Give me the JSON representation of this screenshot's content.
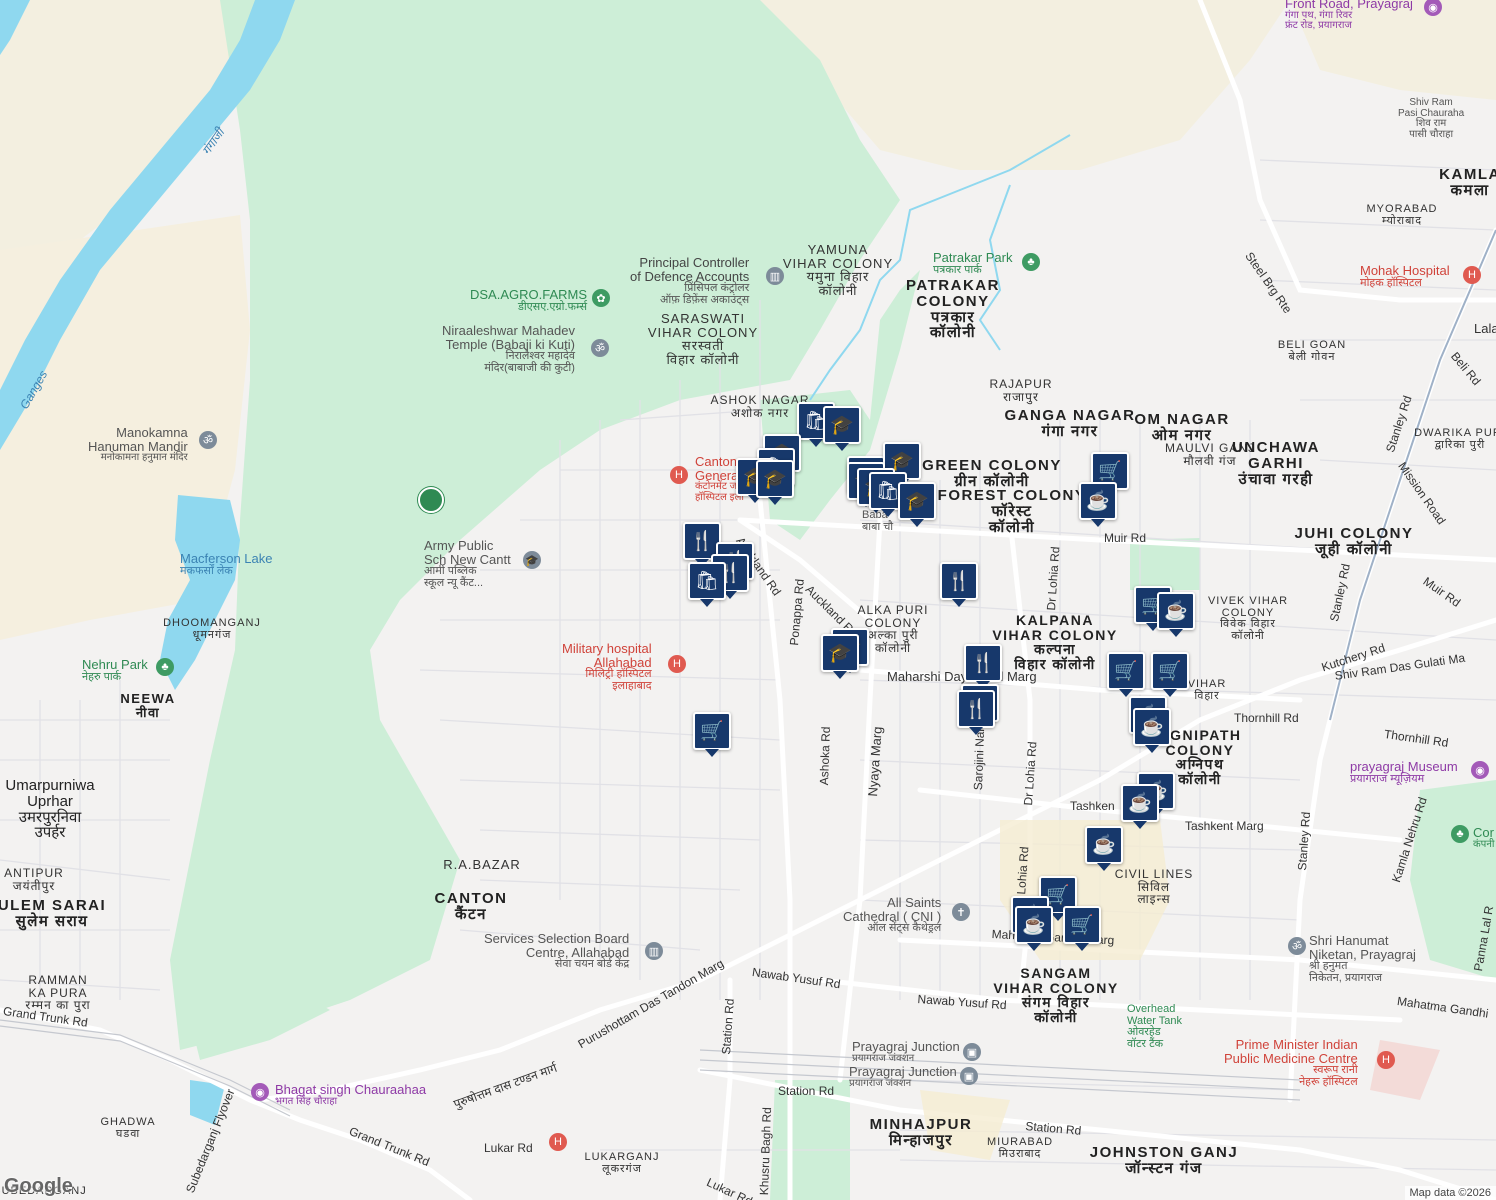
{
  "map": {
    "attribution": "Map data ©2026",
    "logo": "Google",
    "colors": {
      "land": "#f3f2f1",
      "park": "#c8efd5",
      "water": "#8fd8ef",
      "road": "#ffffff",
      "pin": "#17386b"
    },
    "area_labels": [
      {
        "t": "YAMUNA",
        "t2": "VIHAR COLONY",
        "t3": "यमुना विहार",
        "t4": "कॉलोनी"
      },
      {
        "t": "SARASWATI",
        "t2": "VIHAR COLONY",
        "t3": "सरस्वती",
        "t4": "विहार कॉलोनी"
      },
      {
        "t": "PATRAKAR",
        "t2": "COLONY",
        "t3": "पत्रकार",
        "t4": "कॉलोनी"
      },
      {
        "t": "ASHOK NAGAR",
        "t2": "अशोक नगर"
      },
      {
        "t": "RAJAPUR",
        "t2": "राजापुर"
      },
      {
        "t": "GANGA NAGAR",
        "t2": "गंगा नगर"
      },
      {
        "t": "OM NAGAR",
        "t2": "ओम नगर"
      },
      {
        "t": "MAULVI GANJ",
        "t2": "मौलवी गंज"
      },
      {
        "t": "UNCHAWA",
        "t2": "GARHI",
        "t3": "उंचावा गरही"
      },
      {
        "t": "GREEN COLONY",
        "t2": "ग्रीन कॉलोनी"
      },
      {
        "t": "FOREST COLONY",
        "t2": "फॉरेस्ट",
        "t3": "कॉलोनी"
      },
      {
        "t": "JUHI COLONY",
        "t2": "जूही कॉलोनी"
      },
      {
        "t": "BELI GOAN",
        "t2": "बेली गोवन"
      },
      {
        "t": "DWARIKA PURI",
        "t2": "द्वारिका पुरी"
      },
      {
        "t": "KAMLA",
        "t2": "कमला"
      },
      {
        "t": "MYORABAD",
        "t2": "म्योराबाद"
      },
      {
        "t": "ALKA PURI",
        "t2": "COLONY",
        "t3": "अल्का पुरी",
        "t4": "कॉलोनी"
      },
      {
        "t": "KALPANA",
        "t2": "VIHAR COLONY",
        "t3": "कल्पना",
        "t4": "विहार कॉलोनी"
      },
      {
        "t": "VIVEK VIHAR",
        "t2": "COLONY",
        "t3": "विवेक विहार",
        "t4": "कॉलोनी"
      },
      {
        "t": "AGNIPATH",
        "t2": "COLONY",
        "t3": "अग्निपथ",
        "t4": "कॉलोनी"
      },
      {
        "t": "CIVIL LINES",
        "t2": "सिविल",
        "t3": "लाइन्स"
      },
      {
        "t": "NEEWA",
        "t2": "नीवा"
      },
      {
        "t": "DHOOMANGANJ",
        "t2": "धूमनगंज"
      },
      {
        "t": "Umarpurniwa",
        "t2": "Uprhar",
        "t3": "उमरपुरनिवा",
        "t4": "उपर्हर"
      },
      {
        "t": "ANTIPUR",
        "t2": "जयंतीपुर"
      },
      {
        "t": "ULEM SARAI",
        "t2": "सुलेम सराय"
      },
      {
        "t": "RAMMAN",
        "t2": "KA PURA",
        "t3": "रम्मन का पुरा"
      },
      {
        "t": "R.A.BAZAR"
      },
      {
        "t": "CANTON",
        "t2": "कैंटन"
      },
      {
        "t": "SANGAM",
        "t2": "VIHAR COLONY",
        "t3": "संगम विहार",
        "t4": "कॉलोनी"
      },
      {
        "t": "MINHAJPUR",
        "t2": "मिन्हाजपुर"
      },
      {
        "t": "MIURABAD",
        "t2": "मिउराबाद"
      },
      {
        "t": "JOHNSTON GANJ",
        "t2": "जॉन्स्टन गंज"
      },
      {
        "t": "GHADWA",
        "t2": "घडवा"
      },
      {
        "t": "LUKARGANJ",
        "t2": "लूकरगंज"
      },
      {
        "t": "SUBEDARGANJ"
      }
    ],
    "poi_labels": [
      {
        "t": "Principal Controller",
        "t2": "of Defence Accounts",
        "t3": "प्रिंसिपल कंट्रोलर",
        "t4": "ऑफ़ डिफ़ेंस अकाउंट्स"
      },
      {
        "t": "DSA.AGRO.FARMS",
        "t2": "डीएसए.एग्रो.फर्म्स"
      },
      {
        "t": "Niraaleshwar Mahadev",
        "t2": "Temple (Babaji ki Kuti)",
        "t3": "निरालेश्वर महादेव",
        "t4": "मंदिर(बाबाजी की कुटी)"
      },
      {
        "t": "Manokamna",
        "t2": "Hanuman Mandir",
        "t3": "मनोकामना हनुमान मंदिर"
      },
      {
        "t": "Cantonm",
        "t2": "Genera",
        "t3": "कंटोनमेंट ज",
        "t4": "हॉस्पिटल इला"
      },
      {
        "t": "Army Public",
        "t2": "Sch New Cantt",
        "t3": "आर्मी पब्लिक",
        "t4": "स्कूल न्यू कैंट..."
      },
      {
        "t": "Macferson Lake",
        "t2": "मकफर्सों लेक"
      },
      {
        "t": "Nehru Park",
        "t2": "नेहरु पार्क"
      },
      {
        "t": "Military hospital",
        "t2": "Allahabad",
        "t3": "मिलिट्री हॉस्पिटल",
        "t4": "इलाहाबाद"
      },
      {
        "t": "Patrakar Park",
        "t2": "पत्रकार पार्क"
      },
      {
        "t": "Mohak Hospital",
        "t2": "मोहक हॉस्पिटल"
      },
      {
        "t": "Front Road, Prayagraj",
        "t2": "गंगा पथ, गंगा रिवर",
        "t3": "फ्रंट रोड, प्रयागराज"
      },
      {
        "t": "Shiv Ram",
        "t2": "Pasi Chauraha",
        "t3": "शिव राम",
        "t4": "पासी चौराहा"
      },
      {
        "t": "Baba",
        "t2": "बाबा चौ"
      },
      {
        "t": "prayagraj Museum",
        "t2": "प्रयागराज म्यूज़ियम"
      },
      {
        "t": "Cor",
        "t2": "कंपनी"
      },
      {
        "t": "All Saints",
        "t2": "Cathedral ( CNI )",
        "t3": "ऑल सेंट्स कैथेड्रल"
      },
      {
        "t": "Services Selection Board",
        "t2": "Centre, Allahabad",
        "t3": "सेवा चयन बोर्ड केंद्र"
      },
      {
        "t": "Shri Hanumat",
        "t2": "Niketan, Prayagraj",
        "t3": "श्री हनुमत",
        "t4": "निकेतन, प्रयागराज"
      },
      {
        "t": "Overhead",
        "t2": "Water Tank",
        "t3": "ओवरहेड",
        "t4": "वॉटर टैंक"
      },
      {
        "t": "Prayagraj Junction",
        "t2": "प्रयागराज जंक्शन"
      },
      {
        "t": "Prayagraj Junction",
        "t2": "प्रयागराज जंक्शन"
      },
      {
        "t": "Prime Minister Indian",
        "t2": "Public Medicine Centre",
        "t3": "स्वरूप रानी",
        "t4": "नेहरू हॉस्पिटल"
      },
      {
        "t": "Bhagat singh Chauraahaa",
        "t2": "भगत सिंह चौराहा"
      },
      {
        "t": "VIHAR",
        "t2": "विहार"
      }
    ],
    "road_labels": [
      "Muir Rd",
      "Auckland Rd",
      "Auckland Rd",
      "Ponappa Rd",
      "Dr Lohia Rd",
      "Dr Lohia Rd",
      "Dr Lohia Rd",
      "Maharshi Dayanand Marg",
      "Thornhill Rd",
      "Thornhill Rd",
      "Kutchery Rd",
      "Shiv Ram Das Gulati Ma",
      "Tashkent Marg",
      "Tashken",
      "Ashoka Rd",
      "Nyaya Marg",
      "Sarojini Naidu Marg",
      "Mahatma Gandhi Marg",
      "Mahatma Gandhi",
      "Nawab Yusuf Rd",
      "Nawab Yusuf Rd",
      "Station Rd",
      "Station Rd",
      "Station Rd",
      "Purushottam Das Tandon Marg",
      "पुरुषोत्तम दास टण्डन मार्ग",
      "Khusru Bagh Rd",
      "Grand Trunk Rd",
      "Grand Trunk Rd",
      "Lukar Rd",
      "Lukar Rd",
      "Subedarganj Flyover",
      "Stanley Rd",
      "Stanley Rd",
      "Stanley Rd",
      "Kamla Nehru Rd",
      "Mission Road",
      "Muir Rd",
      "Beli Rd",
      "Steel Brg Rte",
      "Lala",
      "Panna Lal R",
      "D"
    ],
    "water_labels": [
      "गंगाजी",
      "Ganges"
    ],
    "markers": [
      {
        "icon": "shopping-bag-icon",
        "g": "🛍"
      },
      {
        "icon": "school-icon",
        "g": "🎓"
      },
      {
        "icon": "school-icon",
        "g": "🎓"
      },
      {
        "icon": "shopping-bag-icon",
        "g": "🛍"
      },
      {
        "icon": "school-icon",
        "g": "🎓"
      },
      {
        "icon": "school-icon",
        "g": "🎓"
      },
      {
        "icon": "shopping-bag-icon",
        "g": "🛍"
      },
      {
        "icon": "school-icon",
        "g": "🎓"
      },
      {
        "icon": "school-icon",
        "g": "🎓"
      },
      {
        "icon": "school-icon",
        "g": "🎓"
      },
      {
        "icon": "shopping-bag-icon",
        "g": "🛍"
      },
      {
        "icon": "school-icon",
        "g": "🎓"
      },
      {
        "icon": "restaurant-icon",
        "g": "🍴"
      },
      {
        "icon": "restaurant-icon",
        "g": "🍴"
      },
      {
        "icon": "restaurant-icon",
        "g": "🍴"
      },
      {
        "icon": "shopping-bag-icon",
        "g": "🛍"
      },
      {
        "icon": "restaurant-icon",
        "g": "🍴"
      },
      {
        "icon": "school-icon",
        "g": "🎓"
      },
      {
        "icon": "school-icon",
        "g": "🎓"
      },
      {
        "icon": "restaurant-icon",
        "g": "🍴"
      },
      {
        "icon": "restaurant-icon",
        "g": "🍴"
      },
      {
        "icon": "restaurant-icon",
        "g": "🍴"
      },
      {
        "icon": "shopping-cart-icon",
        "g": "🛒"
      },
      {
        "icon": "shopping-cart-icon",
        "g": "🛒"
      },
      {
        "icon": "cafe-icon",
        "g": "☕"
      },
      {
        "icon": "shopping-cart-icon",
        "g": "🛒"
      },
      {
        "icon": "cafe-icon",
        "g": "☕"
      },
      {
        "icon": "shopping-cart-icon",
        "g": "🛒"
      },
      {
        "icon": "shopping-cart-icon",
        "g": "🛒"
      },
      {
        "icon": "cafe-icon",
        "g": "☕"
      },
      {
        "icon": "cafe-icon",
        "g": "☕"
      },
      {
        "icon": "cafe-icon",
        "g": "☕"
      },
      {
        "icon": "cafe-icon",
        "g": "☕"
      },
      {
        "icon": "cafe-icon",
        "g": "☕"
      },
      {
        "icon": "shopping-cart-icon",
        "g": "🛒"
      },
      {
        "icon": "cafe-icon",
        "g": "☕"
      },
      {
        "icon": "cafe-icon",
        "g": "☕"
      },
      {
        "icon": "shopping-cart-icon",
        "g": "🛒"
      }
    ]
  }
}
